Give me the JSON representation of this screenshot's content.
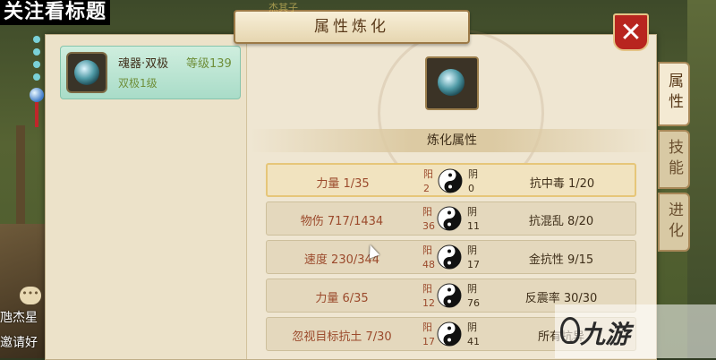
{
  "caption": "关注看标题",
  "top_name": "杰其子",
  "side_names": [
    "虺杰星",
    "邀请好"
  ],
  "chat_icon": "chat-bubble-icon",
  "panel": {
    "title": "属性炼化",
    "close_label": "✕",
    "item": {
      "name": "魂器·双极",
      "level": "等级139",
      "subtitle": "双极1级"
    },
    "section_title": "炼化属性",
    "yang_label": "阳",
    "yin_label": "阴",
    "rows": [
      {
        "left": "力量 1/35",
        "yang": "2",
        "yin": "0",
        "right": "抗中毒 1/20",
        "selected": true
      },
      {
        "left": "物伤 717/1434",
        "yang": "36",
        "yin": "11",
        "right": "抗混乱 8/20",
        "selected": false
      },
      {
        "left": "速度 230/344",
        "yang": "48",
        "yin": "17",
        "right": "金抗性 9/15",
        "selected": false
      },
      {
        "left": "力量 6/35",
        "yang": "12",
        "yin": "76",
        "right": "反震率 30/30",
        "selected": false
      },
      {
        "left": "忽视目标抗土 7/30",
        "yang": "17",
        "yin": "41",
        "right": "所有抗异",
        "selected": false
      }
    ],
    "tabs": [
      {
        "label": "属性",
        "active": true
      },
      {
        "label": "技能",
        "active": false
      },
      {
        "label": "进化",
        "active": false
      }
    ]
  },
  "watermark": "九游",
  "colors": {
    "panel_bg": "#eee5cf",
    "close_red": "#b8251f",
    "attr_left": "#9b4a2c",
    "item_card": "#bfe6d4"
  }
}
